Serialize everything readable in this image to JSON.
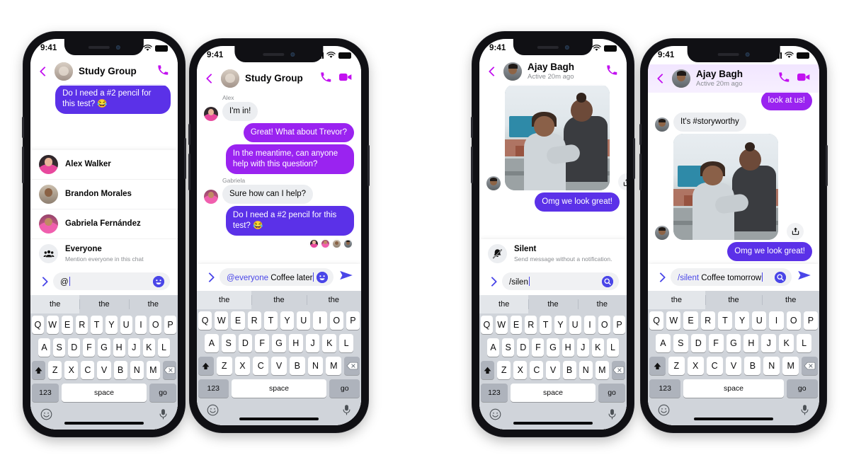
{
  "status_bar": {
    "time": "9:41"
  },
  "keyboard": {
    "predictions": [
      "the",
      "the",
      "the"
    ],
    "row1": [
      "Q",
      "W",
      "E",
      "R",
      "T",
      "Y",
      "U",
      "I",
      "O",
      "P"
    ],
    "row2": [
      "A",
      "S",
      "D",
      "F",
      "G",
      "H",
      "J",
      "K",
      "L"
    ],
    "row3": [
      "Z",
      "X",
      "C",
      "V",
      "B",
      "N",
      "M"
    ],
    "shift_key": "shift-key",
    "backspace_key": "backspace-key",
    "numbers_key": "123",
    "space_key": "space",
    "go_key": "go",
    "emoji_key": "emoji-key",
    "mic_key": "microphone-key"
  },
  "colors": {
    "accent_indigo": "#5b31e8",
    "accent_violet": "#9a23f0",
    "magenta": "#c211f0",
    "incoming_bubble": "#eceef1",
    "input_field": "#f0f1f3",
    "keyboard_bg": "#d0d4da"
  },
  "phones": [
    {
      "id": "phone-mention-list",
      "header": {
        "title": "Study Group",
        "subtitle": "",
        "avatar": "study-group-avatar",
        "show_video": false,
        "tint": false
      },
      "messages": [
        {
          "type": "out",
          "text": "Do I need a #2 pencil for this test? 😂",
          "color": "indigo",
          "clipped": true
        }
      ],
      "suggestions": {
        "title": "mention-suggestions",
        "items": [
          {
            "name": "Alex Walker",
            "desc": "",
            "avatar": "alex-avatar"
          },
          {
            "name": "Brandon Morales",
            "desc": "",
            "avatar": "brandon-avatar"
          },
          {
            "name": "Gabriela Fernández",
            "desc": "",
            "avatar": "gabriela-avatar"
          },
          {
            "name": "Everyone",
            "desc": "Mention everyone in this chat",
            "avatar": "everyone-group-icon"
          }
        ]
      },
      "composer": {
        "token": "",
        "text": "@",
        "right_button": "emoji-button",
        "show_send": false
      }
    },
    {
      "id": "phone-mention-typed",
      "header": {
        "title": "Study Group",
        "subtitle": "",
        "avatar": "study-group-avatar",
        "show_video": true,
        "tint": false
      },
      "messages": [
        {
          "type": "sender",
          "text": "Alex"
        },
        {
          "type": "in",
          "text": "I'm in!",
          "avatar": "alex-avatar"
        },
        {
          "type": "out",
          "text": "Great! What about Trevor?",
          "color": "violet"
        },
        {
          "type": "out",
          "text": "In the meantime, can anyone help with this question?",
          "color": "violet"
        },
        {
          "type": "sender",
          "text": "Gabriela"
        },
        {
          "type": "in",
          "text": "Sure how can I help?",
          "avatar": "gabriela-avatar"
        },
        {
          "type": "out",
          "text": "Do I need a #2 pencil for this test? 😂",
          "color": "indigo"
        },
        {
          "type": "reactions",
          "count": 4
        }
      ],
      "composer": {
        "token": "@everyone",
        "text": "Coffee later",
        "right_button": "emoji-button",
        "show_send": true
      }
    },
    {
      "id": "phone-slash-suggestion",
      "header": {
        "title": "Ajay Bagh",
        "subtitle": "Active 20m ago",
        "avatar": "ajay-avatar",
        "show_video": false,
        "tint": false
      },
      "messages": [
        {
          "type": "photo",
          "avatar": "ajay-avatar",
          "share": "share-button"
        },
        {
          "type": "out",
          "text": "Omg we look great!",
          "color": "indigo",
          "clipped": true
        }
      ],
      "suggestions": {
        "title": "command-suggestions",
        "items": [
          {
            "name": "Silent",
            "desc": "Send message without a notification.",
            "avatar": "bell-slash-icon"
          }
        ]
      },
      "composer": {
        "token": "",
        "text": "/silen",
        "right_button": "search-button",
        "show_send": false
      }
    },
    {
      "id": "phone-slash-typed",
      "header": {
        "title": "Ajay Bagh",
        "subtitle": "Active 20m ago",
        "avatar": "ajay-avatar",
        "show_video": true,
        "tint": true
      },
      "messages": [
        {
          "type": "out",
          "text": "look at us!",
          "color": "violet",
          "clipped": true
        },
        {
          "type": "in",
          "text": "It's #storyworthy",
          "avatar": "ajay-avatar"
        },
        {
          "type": "photo",
          "avatar": "ajay-avatar",
          "share": "share-button"
        },
        {
          "type": "out",
          "text": "Omg we look great!",
          "color": "indigo"
        }
      ],
      "composer": {
        "token": "/silent",
        "text": "Coffee tomorrow",
        "right_button": "search-button",
        "show_send": true
      }
    }
  ]
}
